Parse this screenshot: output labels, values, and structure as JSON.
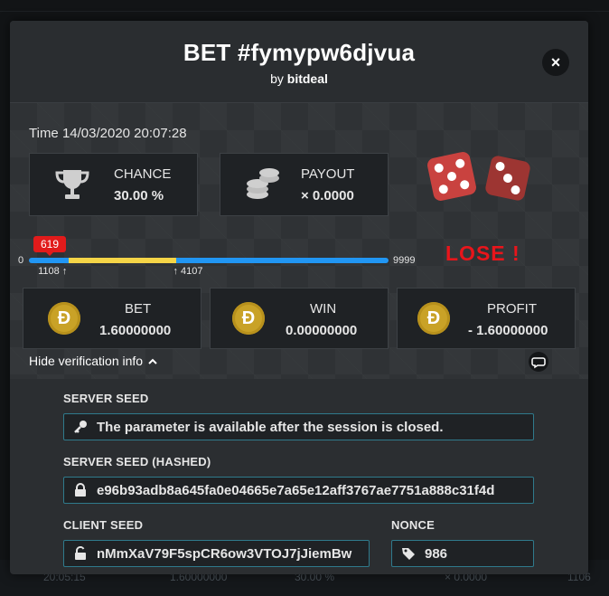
{
  "modal": {
    "title": "BET #fymypw6djvua",
    "by_prefix": "by",
    "by_user": "bitdeal",
    "close_label": "×"
  },
  "bet": {
    "time": "Time 14/03/2020 20:07:28",
    "chance_label": "CHANCE",
    "chance_value": "30.00 %",
    "payout_label": "PAYOUT",
    "payout_value": "× 0.0000",
    "result_label": "LOSE !",
    "range": {
      "min": "0",
      "max": "9999",
      "roll": "619",
      "win_low": "1108",
      "win_high": "4107",
      "win_low_value": 1108,
      "win_high_value": 4107,
      "max_value": 9999
    },
    "bet_label": "BET",
    "bet_value": "1.60000000",
    "win_label": "WIN",
    "win_value": "0.00000000",
    "profit_label": "PROFIT",
    "profit_value": "- 1.60000000",
    "coin_symbol": "Đ"
  },
  "verification": {
    "toggle_label": "Hide verification info",
    "server_seed_label": "SERVER SEED",
    "server_seed_value": "The parameter is available after the session is closed.",
    "server_seed_hashed_label": "SERVER SEED (HASHED)",
    "server_seed_hashed_value": "e96b93adb8a645fa0e04665e7a65e12aff3767ae7751a888c31f4d",
    "client_seed_label": "CLIENT SEED",
    "client_seed_value": "nMmXaV79F5spCR6ow3VTOJ7jJiemBw",
    "nonce_label": "NONCE",
    "nonce_value": "986"
  },
  "background_row": {
    "time": "20:05:15",
    "amount": "1.60000000",
    "chance": "30.00 %",
    "payout": "× 0.0000",
    "roll": "1106"
  },
  "colors": {
    "accent_blue": "#2196f3",
    "win_range_yellow": "#f5d547",
    "lose_red": "#e8151b",
    "coin_gold": "#c9a227",
    "field_border": "#2f7a8c"
  },
  "icons": {
    "close": "close-icon",
    "chance": "trophy-icon",
    "payout": "coin-stack-icon",
    "dice": "dice-icon",
    "coin": "doge-coin-icon",
    "chevron": "chevron-up-icon",
    "chat": "chat-bubble-icon",
    "key": "key-icon",
    "lock": "lock-icon",
    "unlock": "unlock-icon",
    "tag": "tag-icon"
  }
}
